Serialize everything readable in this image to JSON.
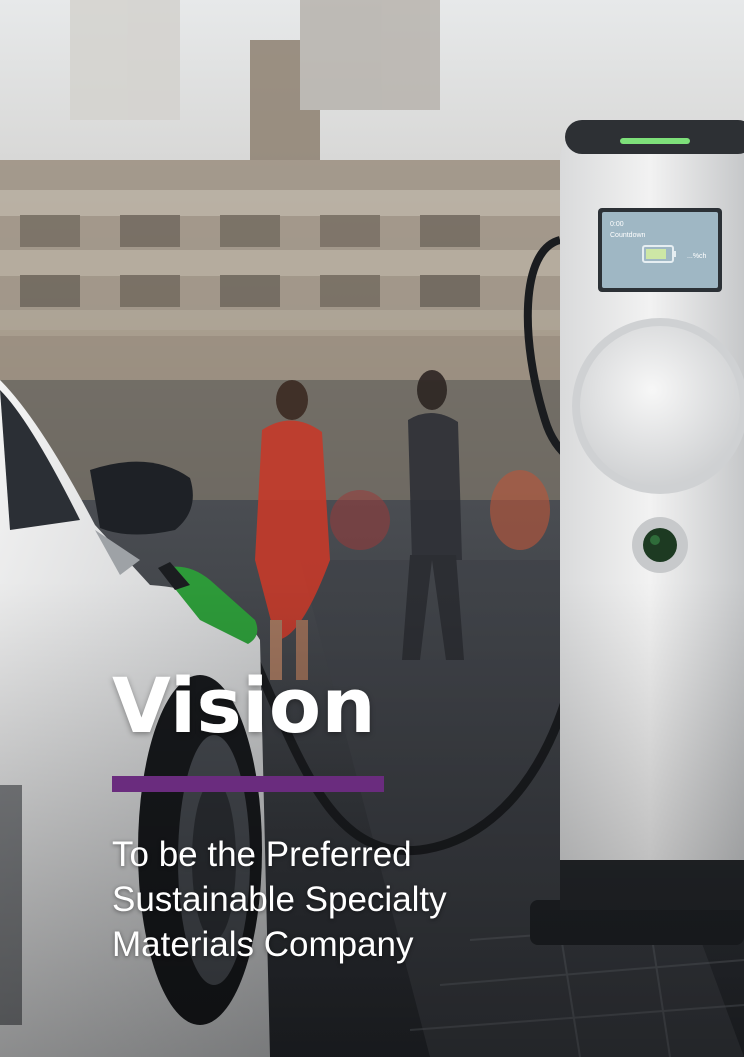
{
  "hero": {
    "title": "Vision",
    "statement_lines": [
      "To be the Preferred",
      "Sustainable Specialty",
      "Materials Company"
    ],
    "accent_color": "#6a2c7e",
    "text_color": "#ffffff"
  },
  "photo": {
    "charger_screen": {
      "line1": "0:00",
      "line2": "Countdown",
      "value": "...%ch"
    }
  }
}
